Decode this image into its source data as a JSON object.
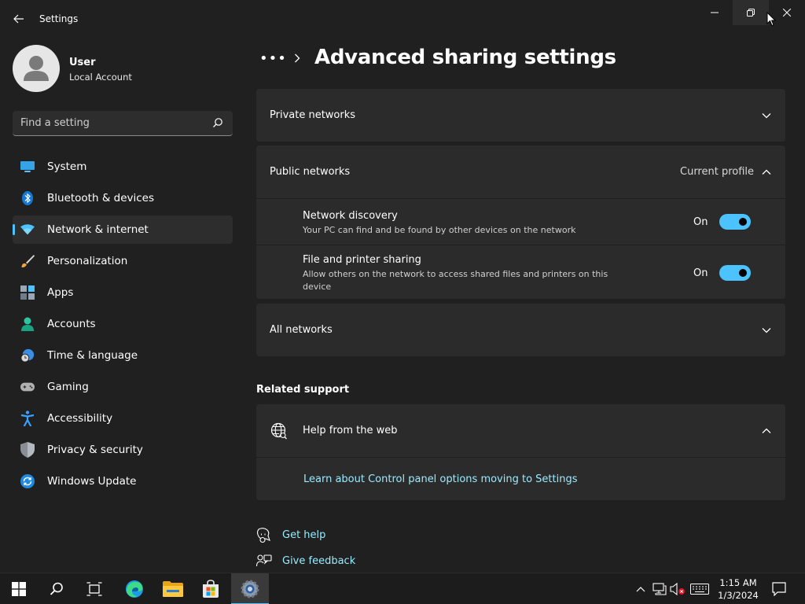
{
  "window": {
    "app_title": "Settings"
  },
  "profile": {
    "name": "User",
    "account_type": "Local Account"
  },
  "search": {
    "placeholder": "Find a setting"
  },
  "sidebar": {
    "items": [
      {
        "label": "System",
        "icon": "system-icon"
      },
      {
        "label": "Bluetooth & devices",
        "icon": "bluetooth-icon"
      },
      {
        "label": "Network & internet",
        "icon": "wifi-icon",
        "active": true
      },
      {
        "label": "Personalization",
        "icon": "paintbrush-icon"
      },
      {
        "label": "Apps",
        "icon": "apps-icon"
      },
      {
        "label": "Accounts",
        "icon": "person-icon"
      },
      {
        "label": "Time & language",
        "icon": "globe-clock-icon"
      },
      {
        "label": "Gaming",
        "icon": "gamepad-icon"
      },
      {
        "label": "Accessibility",
        "icon": "accessibility-icon"
      },
      {
        "label": "Privacy & security",
        "icon": "shield-icon"
      },
      {
        "label": "Windows Update",
        "icon": "update-icon"
      }
    ]
  },
  "header": {
    "breadcrumb_dots": "•••",
    "title": "Advanced sharing settings"
  },
  "sections": {
    "private": {
      "title": "Private networks"
    },
    "public": {
      "title": "Public networks",
      "badge": "Current profile",
      "settings": [
        {
          "title": "Network discovery",
          "description": "Your PC can find and be found by other devices on the network",
          "state": "On",
          "enabled": true
        },
        {
          "title": "File and printer sharing",
          "description": "Allow others on the network to access shared files and printers on this device",
          "state": "On",
          "enabled": true
        }
      ]
    },
    "all": {
      "title": "All networks"
    }
  },
  "related_support": {
    "heading": "Related support",
    "help_title": "Help from the web",
    "link": "Learn about Control panel options moving to Settings"
  },
  "footer": {
    "get_help": "Get help",
    "give_feedback": "Give feedback"
  },
  "taskbar": {
    "time": "1:15 AM",
    "date": "1/3/2024"
  },
  "colors": {
    "accent": "#4cc2ff",
    "link": "#99ebff",
    "background": "#202020",
    "card": "#2b2b2b"
  }
}
